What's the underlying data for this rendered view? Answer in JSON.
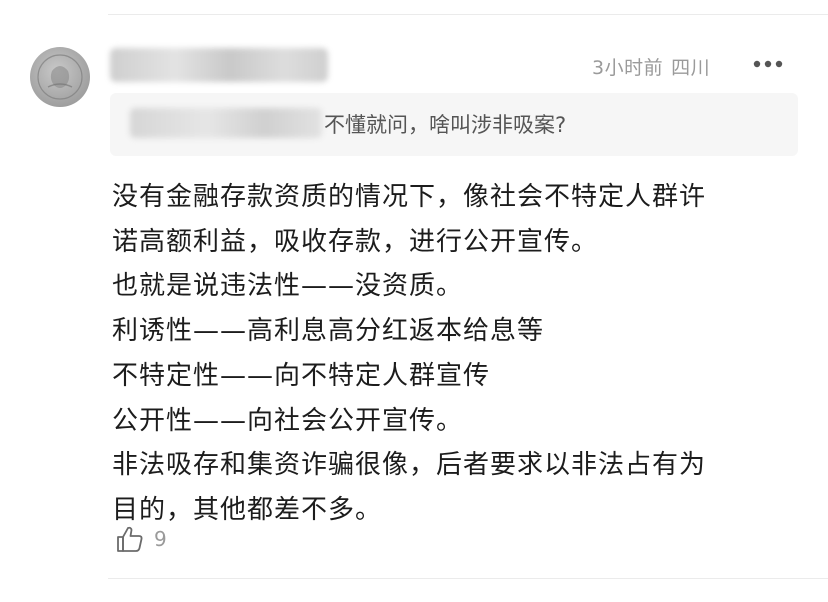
{
  "comment": {
    "username": "",
    "meta_time": "3小时前",
    "meta_location": "四川",
    "more_icon": "more-horizontal-icon",
    "reply_to": {
      "author": "",
      "text": "不懂就问，啥叫涉非吸案?"
    },
    "body_lines": [
      "没有金融存款资质的情况下，像社会不特定人群许",
      "诺高额利益，吸收存款，进行公开宣传。",
      "也就是说违法性——没资质。",
      "利诱性——高利息高分红返本给息等",
      "不特定性——向不特定人群宣传",
      "公开性——向社会公开宣传。",
      "非法吸存和集资诈骗很像，后者要求以非法占有为",
      "目的，其他都差不多。"
    ],
    "like_icon": "thumbs-up-icon",
    "like_count": "9"
  },
  "colors": {
    "meta_text": "#9a9a9a",
    "quote_bg": "#f6f6f6",
    "body_text": "#1c1c1c"
  }
}
